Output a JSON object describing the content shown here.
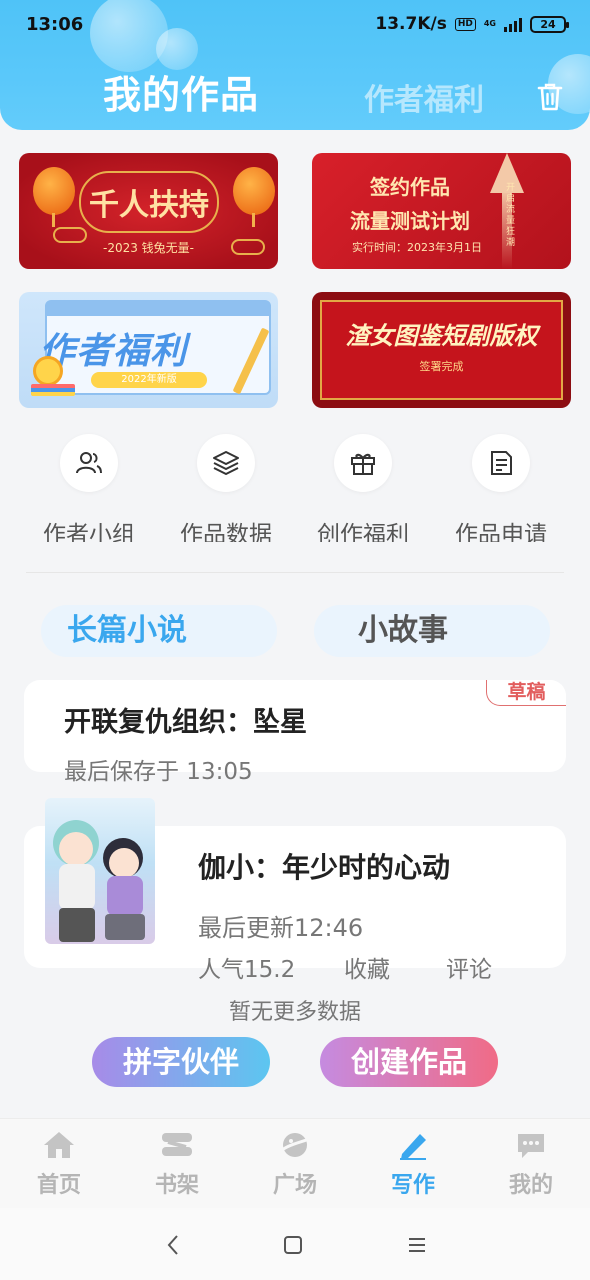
{
  "status": {
    "time": "13:06",
    "network_speed": "13.7K/s",
    "hd": "HD",
    "network_type": "4G",
    "battery": "24"
  },
  "header": {
    "title": "我的作品",
    "alt_tab": "作者福利",
    "delete_icon": "trash-icon",
    "color": "#5ac8fa"
  },
  "banners": [
    {
      "title": "千人扶持",
      "subtitle": "-2023 钱兔无量-"
    },
    {
      "line1": "签约作品",
      "line2": "流量测试计划",
      "line3": "实行时间：2023年3月1日",
      "side": "开启流量狂潮"
    },
    {
      "title": "作者福利",
      "badge": "2022年新版"
    },
    {
      "title": "渣女图鉴短剧版权",
      "subtitle": "签署完成"
    }
  ],
  "quick_actions": [
    {
      "label": "作者小组",
      "icon": "users-icon"
    },
    {
      "label": "作品数据",
      "icon": "layers-icon"
    },
    {
      "label": "创作福利",
      "icon": "gift-icon"
    },
    {
      "label": "作品申请",
      "icon": "document-icon"
    }
  ],
  "tabs": {
    "long_novel": "长篇小说",
    "short_story": "小故事",
    "active": "长篇小说"
  },
  "draft": {
    "tag": "草稿",
    "title": "开联复仇组织：坠星",
    "saved": "最后保存于 13:05"
  },
  "work": {
    "title": "伽小：年少时的心动",
    "updated": "最后更新12:46",
    "popularity": "人气15.2",
    "favorites": "收藏",
    "comments": "评论"
  },
  "no_more": "暂无更多数据",
  "actions": {
    "partner": "拼字伙伴",
    "create": "创建作品"
  },
  "bottom_nav": [
    {
      "label": "首页",
      "icon": "home-icon"
    },
    {
      "label": "书架",
      "icon": "bookshelf-icon"
    },
    {
      "label": "广场",
      "icon": "planet-icon"
    },
    {
      "label": "写作",
      "icon": "pen-icon",
      "active": true
    },
    {
      "label": "我的",
      "icon": "chat-bubble-icon"
    }
  ],
  "colors": {
    "accent": "#3aa7ee",
    "draft_tag": "#e25d5d"
  }
}
